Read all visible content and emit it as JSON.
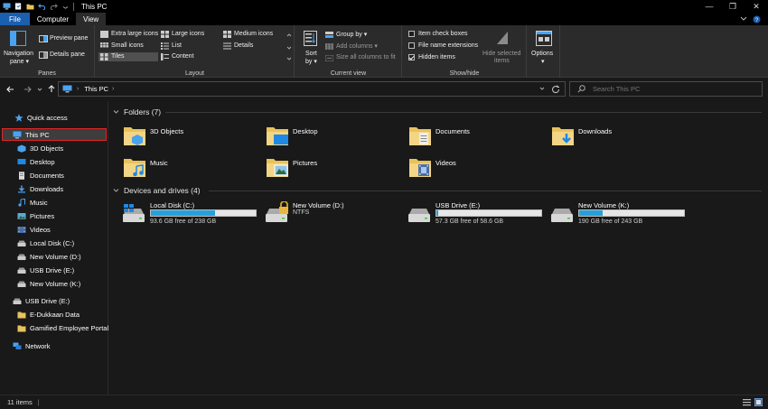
{
  "window": {
    "title": "This PC",
    "controls": [
      "—",
      "❐",
      "✕"
    ]
  },
  "tabs": [
    {
      "label": "File"
    },
    {
      "label": "Computer"
    },
    {
      "label": "View"
    }
  ],
  "ribbon": {
    "panes": {
      "navigation_pane": "Navigation",
      "navigation_pane2": "pane ▾",
      "preview_pane": "Preview pane",
      "details_pane": "Details pane",
      "label": "Panes"
    },
    "layout": {
      "extra_large_icons": "Extra large icons",
      "large_icons": "Large icons",
      "medium_icons": "Medium icons",
      "small_icons": "Small icons",
      "list": "List",
      "details": "Details",
      "tiles": "Tiles",
      "content": "Content",
      "label": "Layout"
    },
    "current_view": {
      "sort_by": "Sort",
      "sort_by2": "by ▾",
      "group_by": "Group by ▾",
      "add_columns": "Add columns ▾",
      "size_all_columns": "Size all columns to fit",
      "label": "Current view"
    },
    "show_hide": {
      "item_check_boxes": "Item check boxes",
      "file_name_extensions": "File name extensions",
      "hidden_items": "Hidden items",
      "hide_selected": "Hide selected",
      "hide_selected2": "items",
      "label": "Show/hide",
      "checks": {
        "item_check_boxes": false,
        "file_name_extensions": false,
        "hidden_items": true
      }
    },
    "options": {
      "label": "Options",
      "arrow": "▾"
    }
  },
  "address": {
    "path": "This PC",
    "search_placeholder": "Search This PC"
  },
  "nav": {
    "quick_access": "Quick access",
    "this_pc": "This PC",
    "children": [
      "3D Objects",
      "Desktop",
      "Documents",
      "Downloads",
      "Music",
      "Pictures",
      "Videos",
      "Local Disk (C:)",
      "New Volume (D:)",
      "USB Drive (E:)",
      "New Volume (K:)"
    ],
    "usb_drive": "USB Drive (E:)",
    "usb_children": [
      "E-Dukkaan Data",
      "Gamified Employee Portal"
    ],
    "network": "Network"
  },
  "content": {
    "folders_header": "Folders (7)",
    "folders": [
      "3D Objects",
      "Desktop",
      "Documents",
      "Downloads",
      "Music",
      "Pictures",
      "Videos"
    ],
    "drives_header": "Devices and drives (4)",
    "drives": [
      {
        "name": "Local Disk (C:)",
        "free": "93.6 GB free of 238 GB",
        "used_fraction": 0.61,
        "fs": ""
      },
      {
        "name": "New Volume (D:)",
        "free": "",
        "used_fraction": 0,
        "fs": "NTFS"
      },
      {
        "name": "USB Drive (E:)",
        "free": "57.3 GB free of 58.6 GB",
        "used_fraction": 0.02,
        "fs": ""
      },
      {
        "name": "New Volume (K:)",
        "free": "190 GB free of 243 GB",
        "used_fraction": 0.22,
        "fs": ""
      }
    ]
  },
  "status": {
    "items": "11 items",
    "separator": "|"
  },
  "colors": {
    "accent": "#1b5fb0",
    "highlight": "#e02525",
    "bar_fill": "#26a0da"
  }
}
